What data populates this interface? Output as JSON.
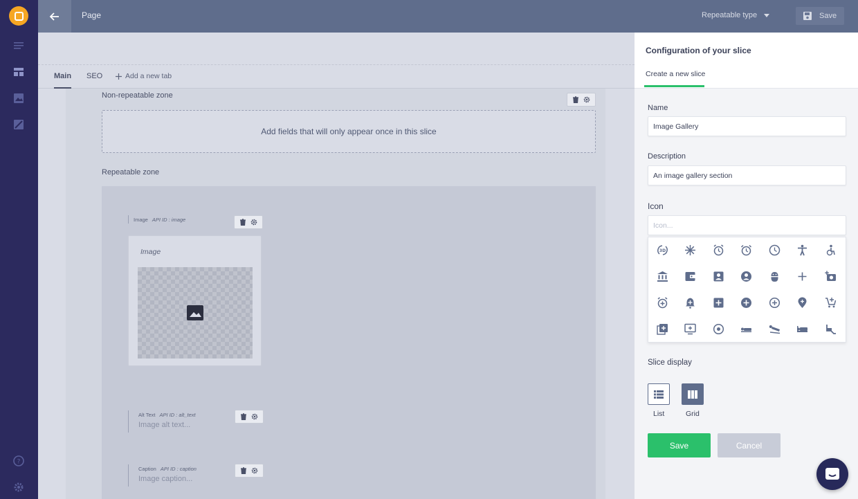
{
  "topbar": {
    "page_title": "Page",
    "repeatable_type": "Repeatable type",
    "save_label": "Save"
  },
  "tabs": [
    {
      "label": "Main"
    },
    {
      "label": "SEO"
    }
  ],
  "add_tab_label": "Add a new tab",
  "non_repeatable": {
    "label": "Non-repeatable zone",
    "placeholder": "Add fields that will only appear once in this slice"
  },
  "repeatable": {
    "label": "Repeatable zone",
    "fields": [
      {
        "name": "Image",
        "api": "API ID : image",
        "title": "Image"
      },
      {
        "name": "Alt Text",
        "api": "API ID : alt_text",
        "placeholder": "Image alt text..."
      },
      {
        "name": "Caption",
        "api": "API ID : caption",
        "placeholder": "Image caption..."
      }
    ]
  },
  "panel": {
    "title": "Configuration of your slice",
    "subtitle": "Create a new slice",
    "name_label": "Name",
    "name_value": "Image Gallery",
    "description_label": "Description",
    "description_value": "An image gallery section",
    "icon_label": "Icon",
    "icon_placeholder": "Icon...",
    "slice_display_label": "Slice display",
    "display_list": "List",
    "display_grid": "Grid",
    "save_label": "Save",
    "cancel_label": "Cancel"
  },
  "icons": [
    "3d-rotation-icon",
    "ac-unit-icon",
    "access-alarm-icon",
    "access-alarms-icon",
    "access-time-icon",
    "accessibility-icon",
    "accessible-icon",
    "account-balance-icon",
    "account-balance-wallet-icon",
    "account-box-icon",
    "account-circle-icon",
    "adb-icon",
    "add-icon",
    "add-a-photo-icon",
    "add-alarm-icon",
    "add-alert-icon",
    "add-box-icon",
    "add-circle-icon",
    "add-circle-outline-icon",
    "add-location-icon",
    "add-shopping-cart-icon",
    "add-to-photos-icon",
    "add-to-queue-icon",
    "adjust-icon",
    "airline-seat-flat-icon",
    "airline-seat-flat-angled-icon",
    "airline-seat-individual-suite-icon",
    "airline-seat-legroom-extra-icon"
  ],
  "colors": {
    "rail": "#2c2a5e",
    "topbar": "#5f6d8c",
    "accent_green": "#2bc06b",
    "logo": "#f6a623"
  }
}
